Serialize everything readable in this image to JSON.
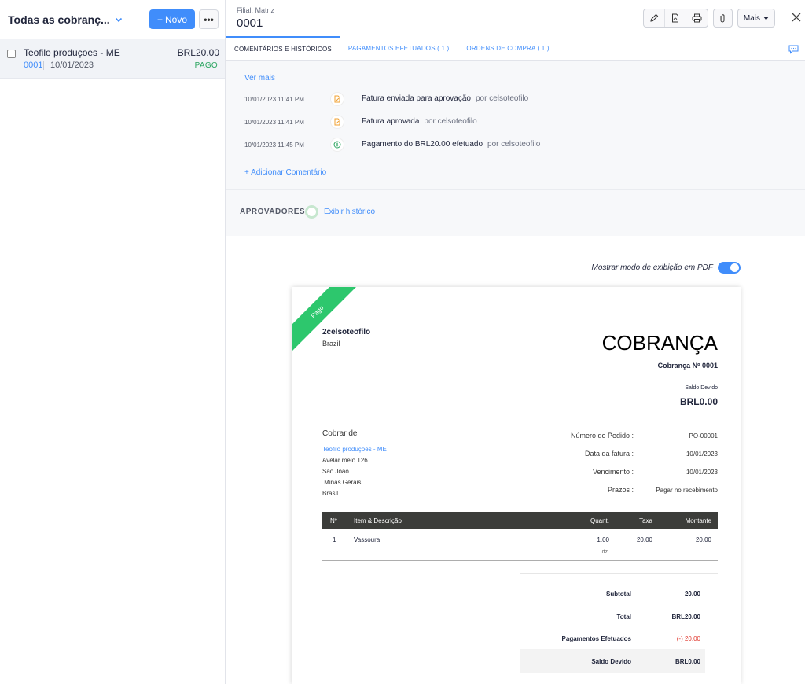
{
  "list": {
    "view_title": "Todas as cobranç...",
    "new_button": "Novo",
    "more_button": "•••",
    "items": [
      {
        "customer": "Teofilo produçoes - ME",
        "amount": "BRL20.00",
        "number": "0001",
        "date": "10/01/2023",
        "status": "PAGO"
      }
    ]
  },
  "detail": {
    "branch": "Filial: Matriz",
    "doc_number": "0001",
    "more_menu": "Mais",
    "tabs": [
      {
        "label": "COMENTÁRIOS E HISTÓRICOS"
      },
      {
        "label": "PAGAMENTOS EFETUADOS ( 1 )"
      },
      {
        "label": "ORDENS DE COMPRA ( 1 )"
      }
    ],
    "ver_mais": "Ver mais",
    "history": [
      {
        "time": "10/01/2023 11:41 PM",
        "text": "Fatura enviada para aprovação",
        "by": "por celsoteofilo",
        "icon": "document-edit-icon"
      },
      {
        "time": "10/01/2023 11:41 PM",
        "text": "Fatura aprovada",
        "by": "por celsoteofilo",
        "icon": "document-edit-icon"
      },
      {
        "time": "10/01/2023 11:45 PM",
        "text": "Pagamento do BRL20.00 efetuado",
        "by": "por celsoteofilo",
        "icon": "money-icon"
      }
    ],
    "add_comment": "+ Adicionar Comentário",
    "approvers_label": "APROVADORES:",
    "approvers_link": "Exibir histórico",
    "pdf_toggle_label": "Mostrar modo de exibição em PDF"
  },
  "invoice": {
    "ribbon": "Pago",
    "org_name": "2celsoteofilo",
    "org_country": "Brazil",
    "title": "COBRANÇA",
    "number_label": "Cobrança Nº 0001",
    "balance_label": "Saldo Devido",
    "balance_value": "BRL0.00",
    "bill_to_label": "Cobrar de",
    "customer_name": "Teofilo produçoes - ME",
    "address": [
      "Avelar melo 126",
      "Sao Joao",
      " Minas Gerais",
      "Brasil"
    ],
    "meta": [
      {
        "label": "Número do Pedido :",
        "value": "PO-00001"
      },
      {
        "label": "Data da fatura :",
        "value": "10/01/2023"
      },
      {
        "label": "Vencimento :",
        "value": "10/01/2023"
      },
      {
        "label": "Prazos :",
        "value": "Pagar no recebimento"
      }
    ],
    "columns": {
      "num": "Nº",
      "desc": "Item & Descrição",
      "qty": "Quant.",
      "rate": "Taxa",
      "amount": "Montante"
    },
    "items": [
      {
        "num": "1",
        "desc": "Vassoura",
        "qty": "1.00",
        "unit": "dz",
        "rate": "20.00",
        "amount": "20.00"
      }
    ],
    "totals": [
      {
        "label": "Subtotal",
        "value": "20.00"
      },
      {
        "label": "Total",
        "value": "BRL20.00"
      },
      {
        "label": "Pagamentos Efetuados",
        "value": "(-) 20.00"
      },
      {
        "label": "Saldo Devido",
        "value": "BRL0.00"
      }
    ]
  },
  "colors": {
    "accent": "#408dfb",
    "paid_green": "#2ba560",
    "ribbon_green": "#2dc76d",
    "negative_red": "#e0362c"
  }
}
